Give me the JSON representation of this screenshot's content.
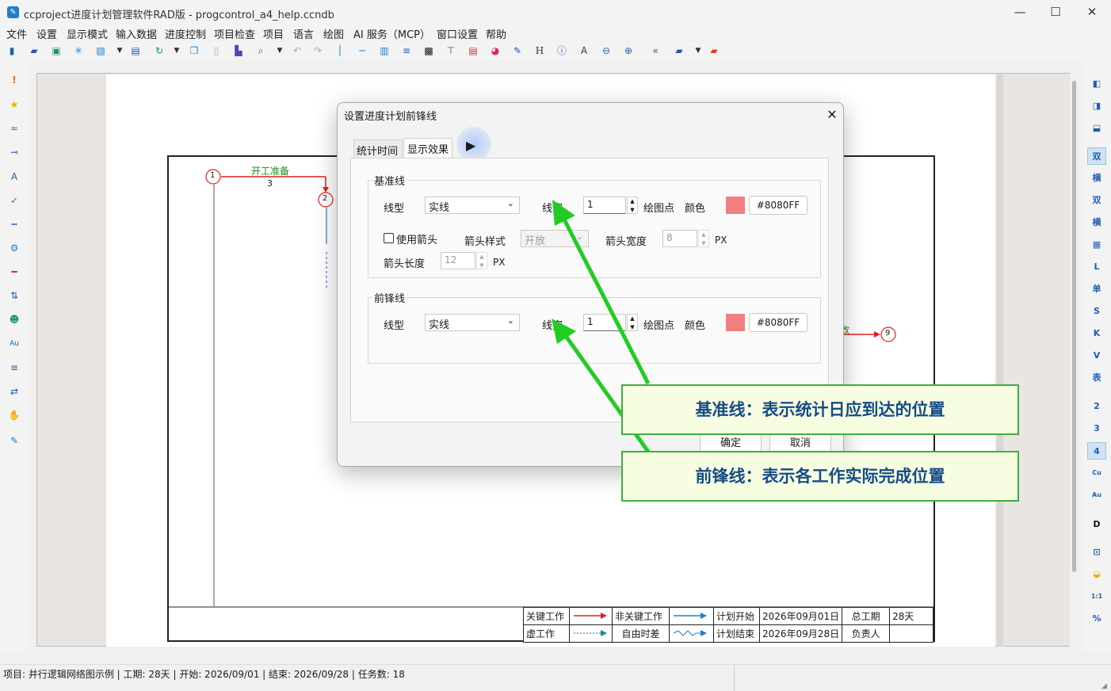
{
  "window": {
    "title": "ccproject进度计划管理软件RAD版 - progcontrol_a4_help.ccndb",
    "minimize": "—",
    "maximize": "☐",
    "close": "✕"
  },
  "menu": [
    "文件",
    "设置",
    "显示模式",
    "输入数据",
    "进度控制",
    "项目检查",
    "项目",
    "语言",
    "绘图",
    "AI 服务（MCP）",
    "窗口设置",
    "帮助"
  ],
  "right_toolbar": [
    "双",
    "横",
    "双",
    "横",
    "L",
    "单",
    "S",
    "K",
    "V",
    "表",
    "2",
    "3",
    "4",
    "Cu",
    "Au",
    "D",
    "1:1",
    "%"
  ],
  "network": {
    "node1": "1",
    "node2": "2",
    "node9": "9",
    "task1_name": "开工准备",
    "task1_duration": "3",
    "partial_label": "改"
  },
  "legend": {
    "critical": "关键工作",
    "noncritical": "非关键工作",
    "plan_start_label": "计划开始",
    "plan_start_value": "2026年09月01日",
    "total_label": "总工期",
    "total_value": "28天",
    "dummy": "虚工作",
    "free_float": "自由时差",
    "plan_end_label": "计划结束",
    "plan_end_value": "2026年09月28日",
    "owner_label": "负责人"
  },
  "status": "项目: 并行逻辑网络图示例 | 工期: 28天 | 开始: 2026/09/01 | 结束: 2026/09/28 | 任务数: 18",
  "dialog": {
    "title": "设置进度计划前锋线",
    "tabs": [
      "统计时间",
      "显示效果"
    ],
    "baseline": {
      "group_label": "基准线",
      "linetype_label": "线型",
      "linetype_value": "实线",
      "width_label": "线宽",
      "width_value": "1",
      "draw_points_label": "绘图点",
      "color_label": "颜色",
      "color_value": "#8080FF",
      "use_arrow_label": "使用箭头",
      "arrow_style_label": "箭头样式",
      "arrow_style_value": "开放",
      "arrow_width_label": "箭头宽度",
      "arrow_width_value": "8",
      "arrow_width_unit": "PX",
      "arrow_length_label": "箭头长度",
      "arrow_length_value": "12",
      "arrow_length_unit": "PX"
    },
    "frontline": {
      "group_label": "前锋线",
      "linetype_label": "线型",
      "linetype_value": "实线",
      "width_label": "线宽",
      "width_value": "1",
      "draw_points_label": "绘图点",
      "color_label": "颜色",
      "color_value": "#8080FF"
    },
    "ok": "确定",
    "cancel": "取消"
  },
  "callouts": {
    "baseline": "基准线：表示统计日应到达的位置",
    "frontline": "前锋线：表示各工作实际完成位置"
  },
  "colors": {
    "accent": "#1e5fb3",
    "callout_border": "#3fae3f",
    "swatch": "#f08080",
    "critical": "#e02020",
    "noncritical": "#1e7fcf"
  }
}
